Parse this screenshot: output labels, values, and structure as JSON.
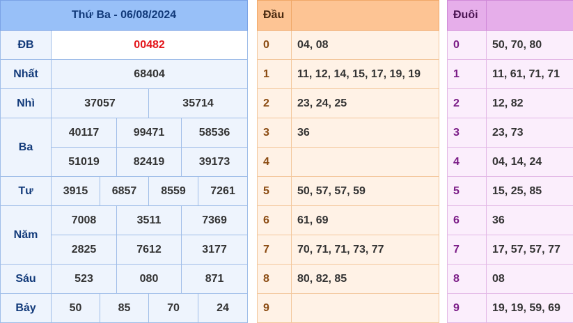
{
  "results": {
    "title": "Thứ Ba - 06/08/2024",
    "db": {
      "label": "ĐB",
      "value": "00482"
    },
    "nhat": {
      "label": "Nhất",
      "value": "68404"
    },
    "nhi": {
      "label": "Nhì",
      "values": [
        "37057",
        "35714"
      ]
    },
    "ba": {
      "label": "Ba",
      "values": [
        "40117",
        "99471",
        "58536",
        "51019",
        "82419",
        "39173"
      ]
    },
    "tu": {
      "label": "Tư",
      "values": [
        "3915",
        "6857",
        "8559",
        "7261"
      ]
    },
    "nam": {
      "label": "Năm",
      "values": [
        "7008",
        "3511",
        "7369",
        "2825",
        "7612",
        "3177"
      ]
    },
    "sau": {
      "label": "Sáu",
      "values": [
        "523",
        "080",
        "871"
      ]
    },
    "bay": {
      "label": "Bảy",
      "values": [
        "50",
        "85",
        "70",
        "24"
      ]
    }
  },
  "heads": {
    "header": "Đầu",
    "rows": [
      {
        "digit": "0",
        "values": "04, 08"
      },
      {
        "digit": "1",
        "values": "11, 12, 14, 15, 17, 19, 19"
      },
      {
        "digit": "2",
        "values": "23, 24, 25"
      },
      {
        "digit": "3",
        "values": "36"
      },
      {
        "digit": "4",
        "values": ""
      },
      {
        "digit": "5",
        "values": "50, 57, 57, 59"
      },
      {
        "digit": "6",
        "values": "61, 69"
      },
      {
        "digit": "7",
        "values": "70, 71, 71, 73, 77"
      },
      {
        "digit": "8",
        "values": "80, 82, 85"
      },
      {
        "digit": "9",
        "values": ""
      }
    ]
  },
  "tails": {
    "header": "Đuôi",
    "rows": [
      {
        "digit": "0",
        "values": "50, 70, 80"
      },
      {
        "digit": "1",
        "values": "11, 61, 71, 71"
      },
      {
        "digit": "2",
        "values": "12, 82"
      },
      {
        "digit": "3",
        "values": "23, 73"
      },
      {
        "digit": "4",
        "values": "04, 14, 24"
      },
      {
        "digit": "5",
        "values": "15, 25, 85"
      },
      {
        "digit": "6",
        "values": "36"
      },
      {
        "digit": "7",
        "values": "17, 57, 57, 77"
      },
      {
        "digit": "8",
        "values": "08"
      },
      {
        "digit": "9",
        "values": "19, 19, 59, 69"
      }
    ]
  }
}
